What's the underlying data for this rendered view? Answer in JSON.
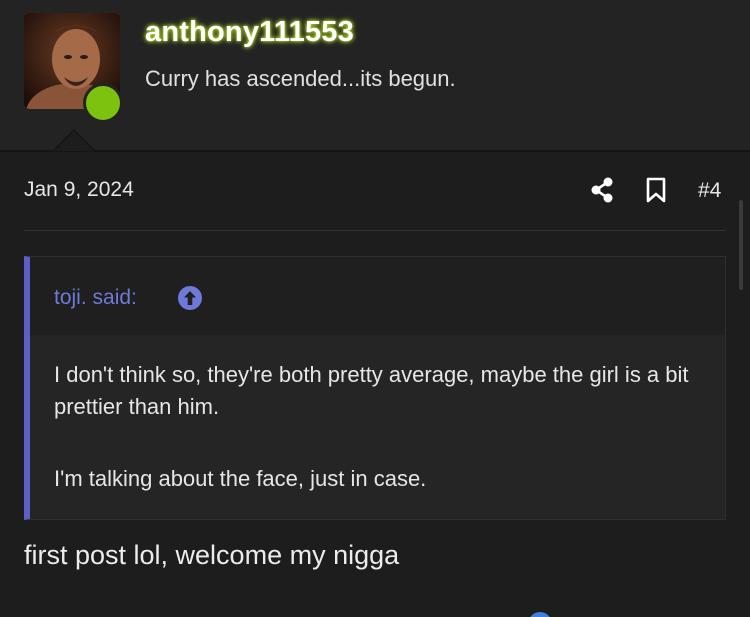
{
  "user": {
    "username": "anthony111553",
    "title": "Curry has ascended...its begun.",
    "online": true,
    "username_glow_color": "#c8f028",
    "online_color": "#7cc20f"
  },
  "post": {
    "date": "Jan 9, 2024",
    "number": "#4",
    "share_icon": "share-icon",
    "bookmark_icon": "bookmark-icon",
    "quote": {
      "attribution": "toji. said:",
      "jump_icon": "arrow-up-circle-icon",
      "paragraphs": [
        "I don't think so, they're both pretty average, maybe the girl is a bit prettier than him.",
        "I'm talking about the face, just in case."
      ],
      "accent_color": "#5b5fc7"
    },
    "body": "first post lol, welcome my nigga"
  }
}
